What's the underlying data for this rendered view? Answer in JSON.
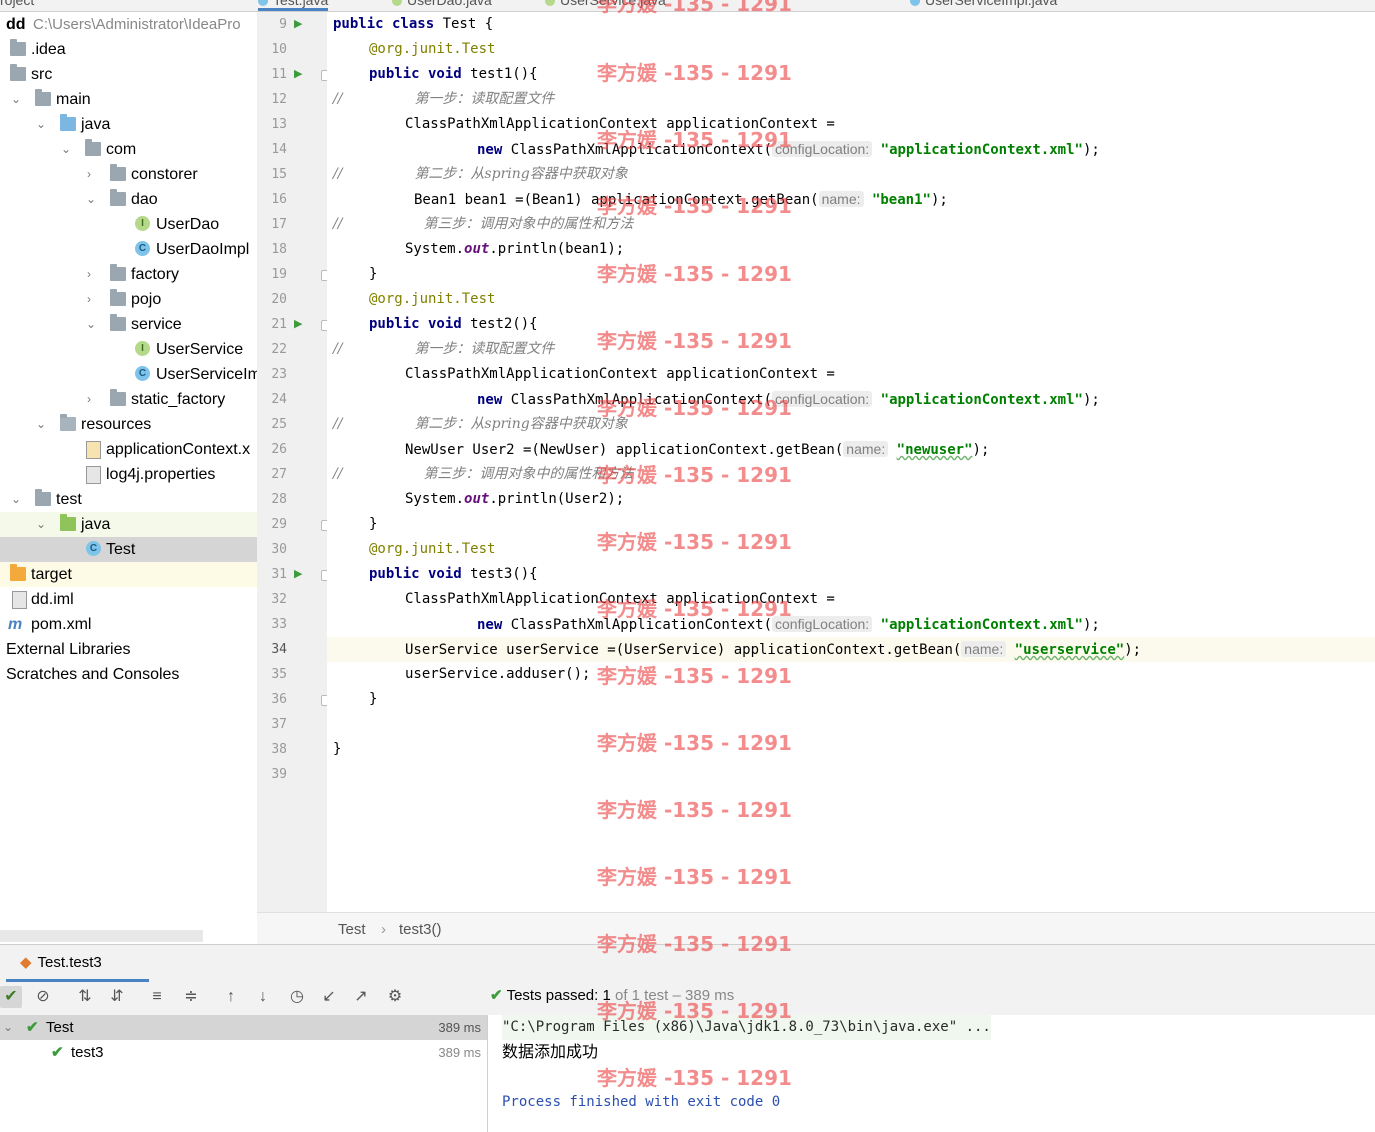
{
  "tabs": [
    {
      "label": "roject"
    },
    {
      "label": "Test.java",
      "active": true
    },
    {
      "label": "UserDao.java"
    },
    {
      "label": "UserService.java"
    },
    {
      "label": "UserServiceImpl.java"
    }
  ],
  "project_tree": {
    "root": {
      "name": "dd",
      "path": "C:\\Users\\Administrator\\IdeaPro"
    },
    "items": [
      {
        "label": ".idea",
        "icon": "folder-icon"
      },
      {
        "label": "src",
        "icon": "folder-icon"
      },
      {
        "label": "main",
        "icon": "folder-icon"
      },
      {
        "label": "java",
        "icon": "source-folder-icon"
      },
      {
        "label": "com",
        "icon": "package-icon"
      },
      {
        "label": "constorer",
        "icon": "package-icon"
      },
      {
        "label": "dao",
        "icon": "package-icon"
      },
      {
        "label": "UserDao",
        "icon": "interface-icon"
      },
      {
        "label": "UserDaoImpl",
        "icon": "class-icon"
      },
      {
        "label": "factory",
        "icon": "package-icon"
      },
      {
        "label": "pojo",
        "icon": "package-icon"
      },
      {
        "label": "service",
        "icon": "package-icon"
      },
      {
        "label": "UserService",
        "icon": "interface-icon"
      },
      {
        "label": "UserServiceIm",
        "icon": "class-icon"
      },
      {
        "label": "static_factory",
        "icon": "package-icon"
      },
      {
        "label": "resources",
        "icon": "resources-folder-icon"
      },
      {
        "label": "applicationContext.x",
        "icon": "xml-file-icon"
      },
      {
        "label": "log4j.properties",
        "icon": "properties-file-icon"
      },
      {
        "label": "test",
        "icon": "folder-icon"
      },
      {
        "label": "java",
        "icon": "test-source-folder-icon"
      },
      {
        "label": "Test",
        "icon": "test-class-icon"
      },
      {
        "label": "target",
        "icon": "excluded-folder-icon"
      },
      {
        "label": "dd.iml",
        "icon": "iml-file-icon"
      },
      {
        "label": "pom.xml",
        "icon": "maven-icon"
      },
      {
        "label": "External Libraries",
        "icon": "libraries-icon"
      },
      {
        "label": "Scratches and Consoles",
        "icon": "scratches-icon"
      }
    ]
  },
  "editor": {
    "line_numbers": [
      "9",
      "10",
      "11",
      "12",
      "13",
      "14",
      "15",
      "16",
      "17",
      "18",
      "19",
      "20",
      "21",
      "22",
      "23",
      "24",
      "25",
      "26",
      "27",
      "28",
      "29",
      "30",
      "31",
      "32",
      "33",
      "34",
      "35",
      "36",
      "37",
      "38",
      "39"
    ],
    "code": {
      "l9_kw": "public class ",
      "l9_rest": "Test {",
      "l10_ann": "@org.junit.",
      "l10_tag": "Test",
      "l11_kw": "public void ",
      "l11_rest": "test1(){",
      "l12_c": "//",
      "l12_txt": "第一步：读取配置文件",
      "l13": "ClassPathXmlApplicationContext applicationContext =",
      "l14_kw": "new ",
      "l14_cls": "ClassPathXmlApplicationContext(",
      "l14_hint": "configLocation:",
      "l14_str": "\"applicationContext.xml\"",
      "l14_end": ");",
      "l15_c": "//",
      "l15_txt": "第二步：从spring容器中获取对象",
      "l16_a": "Bean1 bean1 =(Bean1) applicationContext.getBean(",
      "l16_hint": "name:",
      "l16_str": "\"bean1\"",
      "l16_end": ");",
      "l17_c": "//",
      "l17_txt": "第三步：调用对象中的属性和方法",
      "l18_a": "System.",
      "l18_out": "out",
      "l18_b": ".println(bean1);",
      "l19": "}",
      "l20_ann": "@org.junit.",
      "l20_tag": "Test",
      "l21_kw": "public void ",
      "l21_rest": "test2(){",
      "l22_c": "//",
      "l22_txt": "第一步：读取配置文件",
      "l23": "ClassPathXmlApplicationContext applicationContext =",
      "l24_kw": "new ",
      "l24_cls": "ClassPathXmlApplicationContext(",
      "l24_hint": "configLocation:",
      "l24_str": "\"applicationContext.xml\"",
      "l24_end": ");",
      "l25_c": "//",
      "l25_txt": "第二步：从spring容器中获取对象",
      "l26_a": "NewUser User2 =(NewUser) applicationContext.getBean(",
      "l26_hint": "name:",
      "l26_str": "\"newuser\"",
      "l26_end": ");",
      "l27_c": "//",
      "l27_txt": "第三步：调用对象中的属性和方法",
      "l28_a": "System.",
      "l28_out": "out",
      "l28_b": ".println(User2);",
      "l29": "}",
      "l30_ann": "@org.junit.",
      "l30_tag": "Test",
      "l31_kw": "public void ",
      "l31_rest": "test3(){",
      "l32": "ClassPathXmlApplicationContext applicationContext =",
      "l33_kw": "new ",
      "l33_cls": "ClassPathXmlApplicationContext(",
      "l33_hint": "configLocation:",
      "l33_str": "\"applicationContext.xml\"",
      "l33_end": ");",
      "l34_a": "UserService userService =(UserService) applicationContext.getBean(",
      "l34_hint": "name:",
      "l34_str": "\"userservice\"",
      "l34_end": ");",
      "l35": "userService.adduser();",
      "l36": "}",
      "l38": "}"
    }
  },
  "breadcrumb": {
    "class": "Test",
    "sep": "›",
    "method": "test3()"
  },
  "run_panel": {
    "tab_label": "Test.test3",
    "status_prefix": "Tests passed:",
    "status_count": "1",
    "status_suffix": "of 1 test – 389 ms",
    "tree": [
      {
        "label": "Test",
        "time": "389 ms"
      },
      {
        "label": "test3",
        "time": "389 ms"
      }
    ],
    "console": {
      "cmd": "\"C:\\Program Files (x86)\\Java\\jdk1.8.0_73\\bin\\java.exe\" ...",
      "output": "数据添加成功",
      "exit": "Process finished with exit code 0"
    }
  },
  "watermark": {
    "text": "李方媛 -135 - 1291"
  },
  "colors": {
    "accent": "#4a83c4",
    "pass_green": "#3c9c3c",
    "keyword": "#000080",
    "string": "#008000",
    "watermark": "#ec4646"
  }
}
